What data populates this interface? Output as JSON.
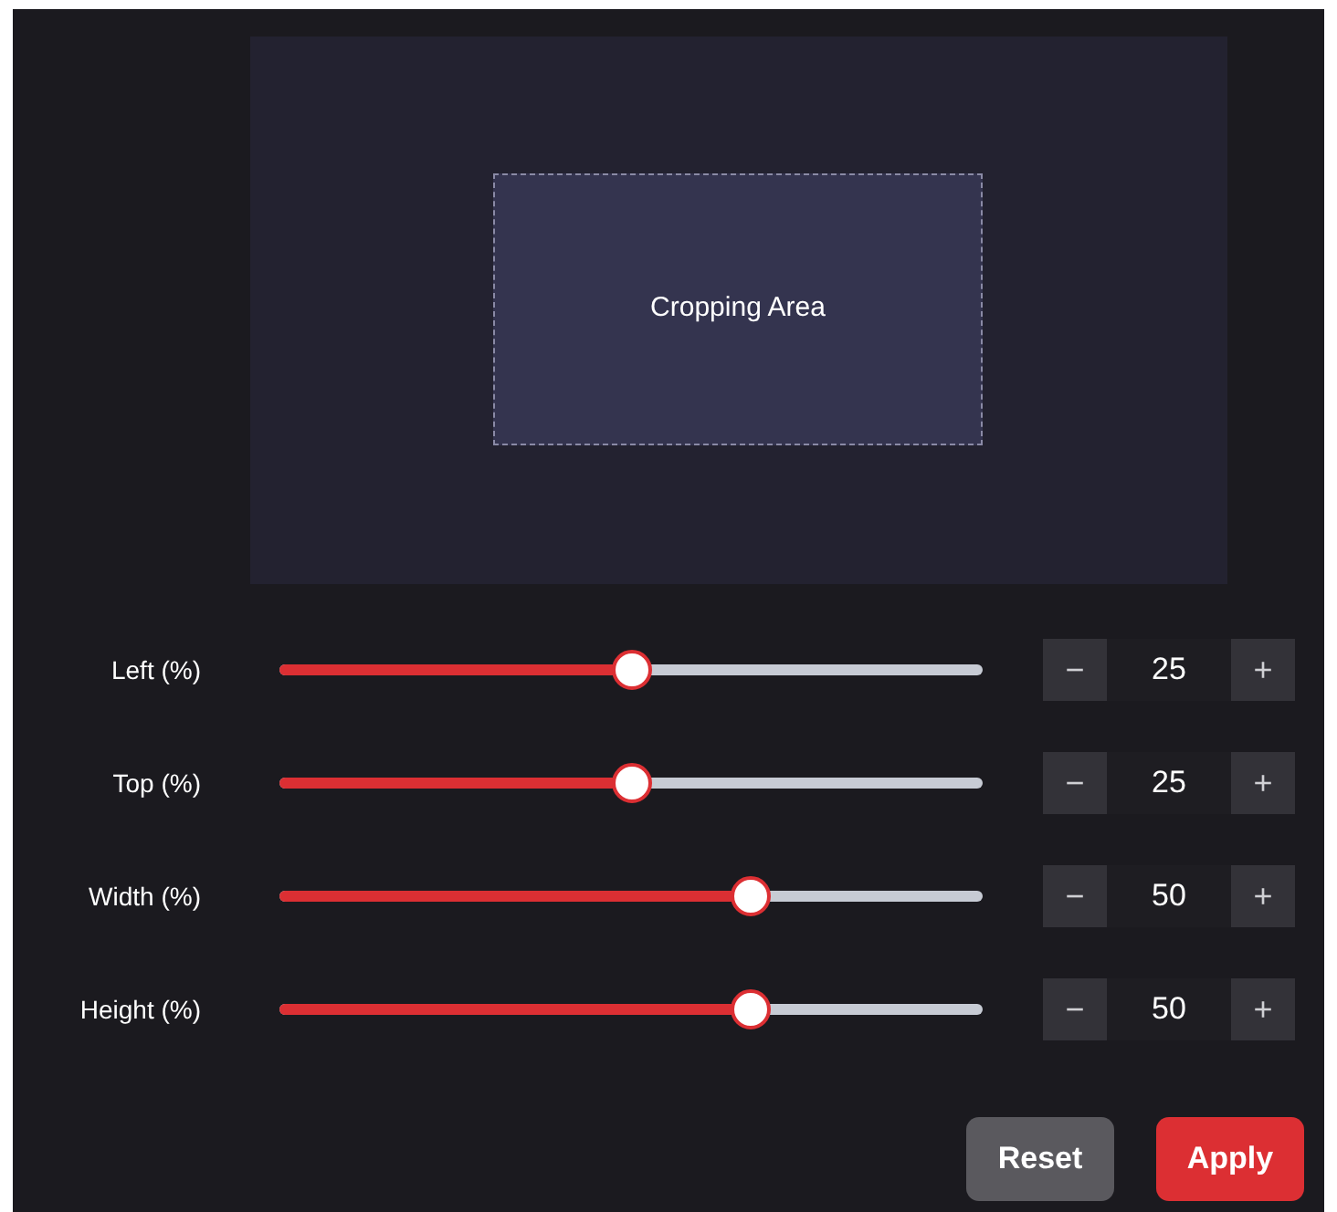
{
  "preview": {
    "label": "Cropping Area"
  },
  "controls": [
    {
      "label": "Left (%)",
      "level": 0.5,
      "value": "25",
      "decrement": "−",
      "increment": "+"
    },
    {
      "label": "Top (%)",
      "level": 0.5,
      "value": "25",
      "decrement": "−",
      "increment": "+"
    },
    {
      "label": "Width (%)",
      "level": 0.67,
      "value": "50",
      "decrement": "−",
      "increment": "+"
    },
    {
      "label": "Height (%)",
      "level": 0.67,
      "value": "50",
      "decrement": "−",
      "increment": "+"
    }
  ],
  "buttons": [
    {
      "label": "Reset",
      "kind": "secondary"
    },
    {
      "label": "Apply",
      "kind": "primary"
    }
  ]
}
